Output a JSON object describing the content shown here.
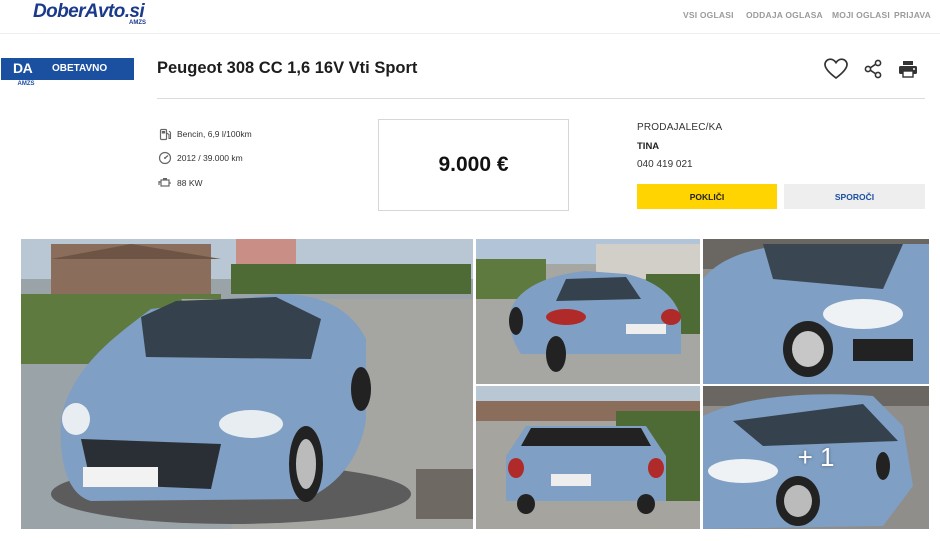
{
  "brand": {
    "name": "DoberAvto.si",
    "sub": "AMZS"
  },
  "nav": [
    "VSI OGLASI",
    "ODDAJA OGLASA",
    "MOJI OGLASI",
    "PRIJAVA"
  ],
  "badge": {
    "mark": "DA",
    "label": "OBETAVNO",
    "sub": "AMZS"
  },
  "listing": {
    "title": "Peugeot 308 CC 1,6 16V Vti Sport",
    "specs": [
      {
        "icon": "fuel-pump-icon",
        "text": "Bencin, 6,9 l/100km"
      },
      {
        "icon": "speedometer-icon",
        "text": "2012 / 39.000 km"
      },
      {
        "icon": "engine-icon",
        "text": "88 KW"
      }
    ],
    "price": "9.000 €"
  },
  "seller": {
    "heading": "PRODAJALEC/KA",
    "name": "TINA",
    "phone": "040 419 021",
    "call_label": "POKLIČI",
    "message_label": "SPOROČI"
  },
  "actions": [
    "heart-icon",
    "share-icon",
    "print-icon"
  ],
  "gallery": {
    "more_label": "+ 1"
  },
  "colors": {
    "brand_blue": "#1b4fa0",
    "accent_yellow": "#ffd400",
    "car_blue": "#7f9fc4"
  }
}
